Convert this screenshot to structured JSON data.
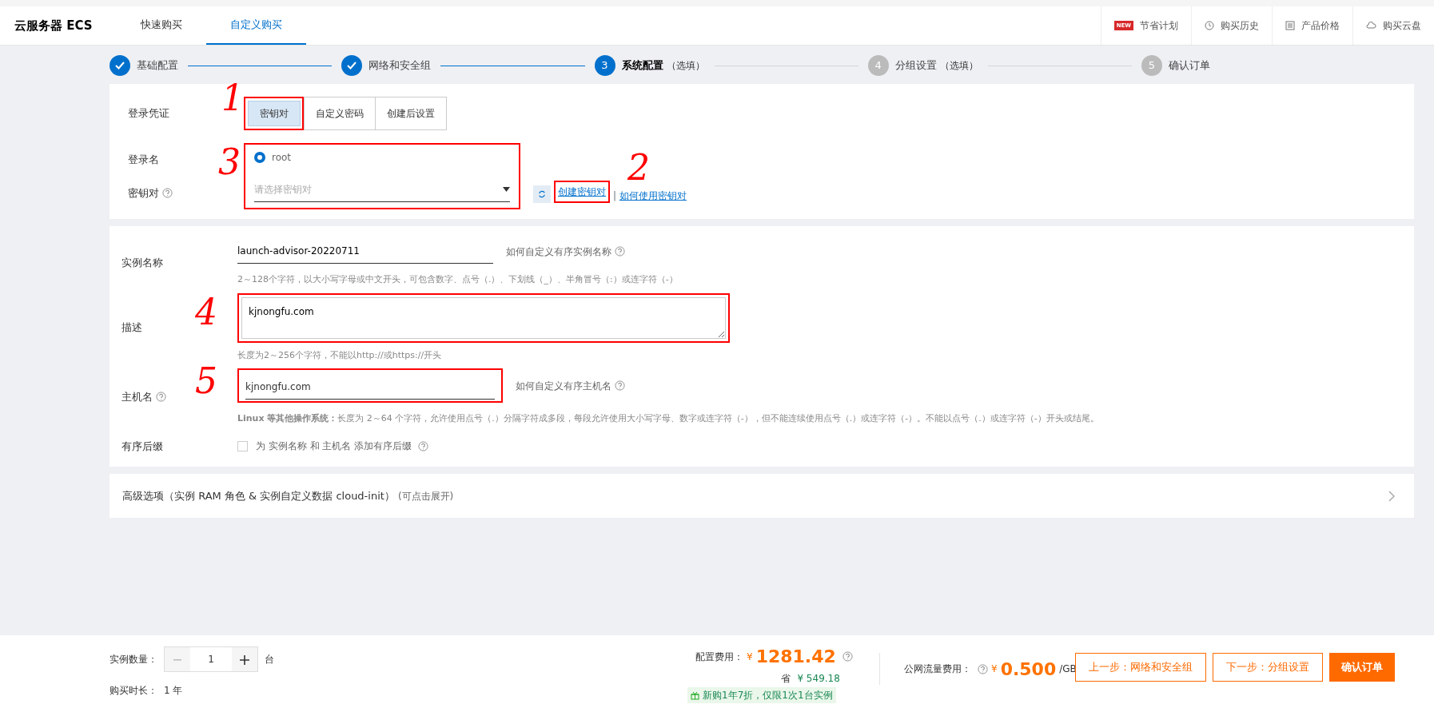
{
  "header": {
    "title": "云服务器 ECS",
    "tabs": [
      {
        "label": "快速购买",
        "selected": false
      },
      {
        "label": "自定义购买",
        "selected": true
      }
    ],
    "links": [
      {
        "kind": "new",
        "badge": "NEW",
        "label": "节省计划"
      },
      {
        "kind": "clock",
        "label": "购买历史"
      },
      {
        "kind": "list",
        "label": "产品价格"
      },
      {
        "kind": "cloud",
        "label": "购买云盘"
      }
    ]
  },
  "steps": [
    {
      "label": "基础配置",
      "completed": true,
      "selected": false
    },
    {
      "label": "网络和安全组",
      "completed": true,
      "selected": false
    },
    {
      "number": "3",
      "label": "系统配置",
      "note": "（选填）",
      "completed": false,
      "selected": true
    },
    {
      "number": "4",
      "label": "分组设置",
      "note": "（选填）",
      "completed": false,
      "selected": false
    },
    {
      "number": "5",
      "label": "确认订单",
      "completed": false,
      "selected": false
    }
  ],
  "login": {
    "credential_label": "登录凭证",
    "credential_options": [
      {
        "label": "密钥对",
        "selected": true
      },
      {
        "label": "自定义密码",
        "selected": false
      },
      {
        "label": "创建后设置",
        "selected": false
      }
    ],
    "user_label": "登录名",
    "user_options": [
      {
        "label": "root",
        "selected": true
      }
    ],
    "keypair_label": "密钥对",
    "keypair_placeholder": "请选择密钥对",
    "create_link": "创建密钥对",
    "credential_annotation": "1",
    "create_annotation": "2",
    "user_annotation": "3",
    "separator": "|",
    "help_link": "如何使用密钥对"
  },
  "instance": {
    "name_label": "实例名称",
    "name_value": "launch-advisor-20220711",
    "name_help": "如何自定义有序实例名称",
    "name_hint": "2～128个字符，以大小写字母或中文开头，可包含数字、点号（.）、下划线（_）、半角冒号（:）或连字符（-）",
    "desc_label": "描述",
    "desc_value": "kjnongfu.com",
    "desc_annotation": "4",
    "host_annotation": "5",
    "desc_hint": "长度为2～256个字符，不能以http://或https://开头",
    "host_label": "主机名",
    "host_value": "kjnongfu.com",
    "host_help": "如何自定义有序主机名",
    "host_hint": "**Linux 等其他操作系统：**长度为 2～64 个字符，允许使用点号（.）分隔字符成多段，每段允许使用大小写字母、数字或连字符（-），但不能连续使用点号（.）或连字符（-）。不能以点号（.）或连字符（-）开头或结尾。",
    "suffix_label": "有序后缀",
    "suffix_checked": false,
    "suffix_text": "为 实例名称 和 主机名 添加有序后缀"
  },
  "advanced": {
    "title": "高级选项（实例 RAM 角色 & 实例自定义数据 cloud-init）",
    "note": "(可点击展开)"
  },
  "footer": {
    "count_label": "实例数量：",
    "count_value": "1",
    "count_unit": "台",
    "duration_label": "购买时长：",
    "duration_value": "1 年",
    "config_label": "配置费用：",
    "config_currency": "¥",
    "config_price": "1281.42",
    "save_label": "省",
    "save_value": "¥ 549.18",
    "promo": "新购1年7折，仅限1次1台实例",
    "traffic_label": "公网流量费用：",
    "traffic_currency": "¥",
    "traffic_price": "0.500",
    "traffic_unit": "/GB",
    "buttons": [
      {
        "label": "上一步：网络和安全组",
        "kind": "outline"
      },
      {
        "label": "下一步：分组设置",
        "kind": "outline"
      },
      {
        "label": "确认订单",
        "kind": "primary"
      }
    ]
  }
}
